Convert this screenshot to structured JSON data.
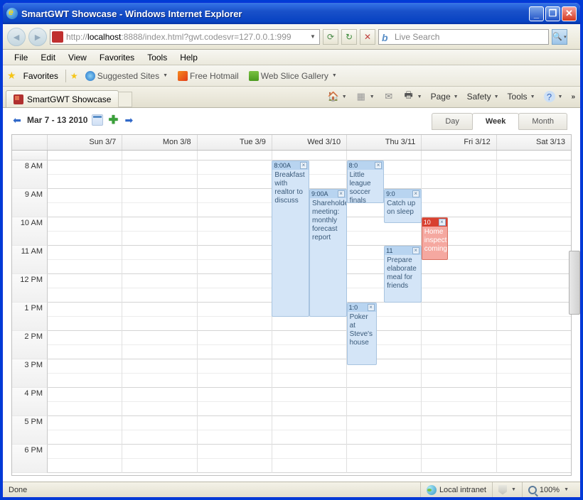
{
  "window": {
    "title": "SmartGWT Showcase - Windows Internet Explorer"
  },
  "nav": {
    "url_prefix": "http://",
    "url_host": "localhost",
    "url_rest": ":8888/index.html?gwt.codesvr=127.0.0.1:999",
    "search_placeholder": "Live Search"
  },
  "menu": {
    "file": "File",
    "edit": "Edit",
    "view": "View",
    "favorites": "Favorites",
    "tools": "Tools",
    "help": "Help"
  },
  "favbar": {
    "favorites": "Favorites",
    "suggested": "Suggested Sites",
    "hotmail": "Free Hotmail",
    "slice": "Web Slice Gallery"
  },
  "tab": {
    "title": "SmartGWT Showcase"
  },
  "tabtools": {
    "page": "Page",
    "safety": "Safety",
    "tools": "Tools"
  },
  "calendar": {
    "range": "Mar 7 - 13 2010",
    "views": {
      "day": "Day",
      "week": "Week",
      "month": "Month"
    },
    "days": [
      "Sun 3/7",
      "Mon 3/8",
      "Tue 3/9",
      "Wed 3/10",
      "Thu 3/11",
      "Fri 3/12",
      "Sat 3/13"
    ],
    "hours": [
      "8 AM",
      "9 AM",
      "10 AM",
      "11 AM",
      "12 PM",
      "1 PM",
      "2 PM",
      "3 PM",
      "4 PM",
      "5 PM",
      "6 PM"
    ],
    "events": {
      "wed1": {
        "time": "8:00A",
        "text": "Breakfast with realtor to discuss"
      },
      "wed2": {
        "time": "9:00A",
        "text": "Shareholder meeting: monthly forecast report"
      },
      "thu1": {
        "time": "8:0",
        "text": "Little league soccer finals"
      },
      "thu2": {
        "time": "9:0",
        "text": "Catch up on sleep"
      },
      "thu3": {
        "time": "11",
        "text": "Prepare elaborate meal for friends"
      },
      "thu4": {
        "time": "1:0",
        "text": "Poker at Steve's house"
      },
      "fri1": {
        "time": "10",
        "text": "Home inspection coming"
      }
    }
  },
  "status": {
    "done": "Done",
    "zone": "Local intranet",
    "zoom": "100%"
  }
}
